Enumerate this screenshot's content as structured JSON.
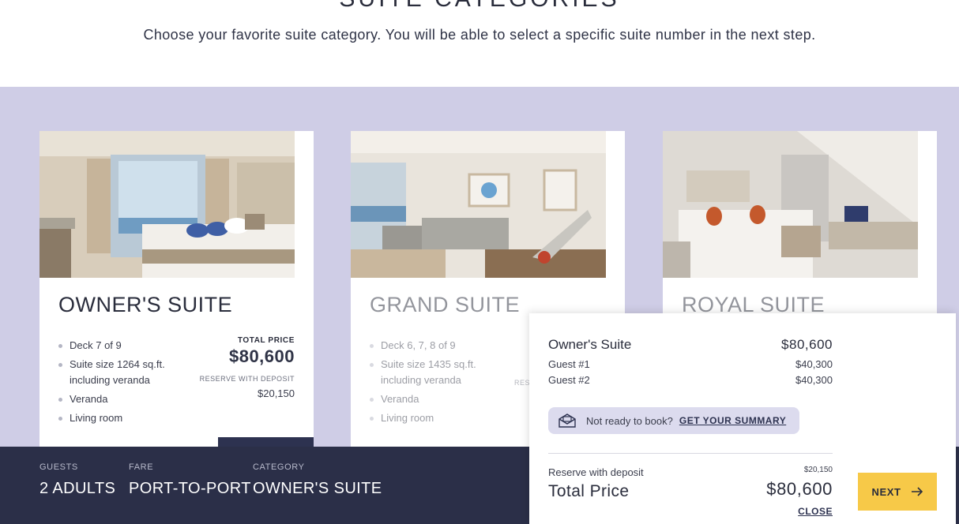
{
  "header": {
    "title": "SUITE CATEGORIES",
    "subtitle": "Choose your favorite suite category. You will be able to select a specific suite number in the next step."
  },
  "labels": {
    "total_price": "TOTAL PRICE",
    "reserve_with_deposit": "RESERVE WITH DEPOSIT"
  },
  "suites": [
    {
      "name": "OWNER'S SUITE",
      "features": [
        "Deck 7 of 9",
        "Suite size 1264 sq.ft. including veranda",
        "Veranda",
        "Living room"
      ],
      "total_price": "$80,600",
      "deposit": "$20,150"
    },
    {
      "name": "GRAND SUITE",
      "features": [
        "Deck 6, 7, 8 of 9",
        "Suite size 1435 sq.ft. including veranda",
        "Veranda",
        "Living room"
      ],
      "reserve_label_partial": "RES"
    },
    {
      "name": "ROYAL SUITE"
    }
  ],
  "booking_bar": {
    "guests_label": "GUESTS",
    "guests_value": "2 ADULTS",
    "fare_label": "FARE",
    "fare_value": "PORT-TO-PORT",
    "category_label": "CATEGORY",
    "category_value": "OWNER'S SUITE"
  },
  "summary": {
    "suite_name": "Owner's Suite",
    "suite_price": "$80,600",
    "guests": [
      {
        "label": "Guest #1",
        "price": "$40,300"
      },
      {
        "label": "Guest #2",
        "price": "$40,300"
      }
    ],
    "not_ready_text": "Not ready to book?",
    "summary_link": "GET YOUR SUMMARY",
    "deposit_label": "Reserve with deposit",
    "deposit_value": "$20,150",
    "total_label": "Total Price",
    "total_value": "$80,600",
    "close_label": "CLOSE",
    "next_label": "NEXT"
  },
  "colors": {
    "band": "#cfcde6",
    "navy": "#2b2f48",
    "accent_yellow": "#f7c948"
  }
}
